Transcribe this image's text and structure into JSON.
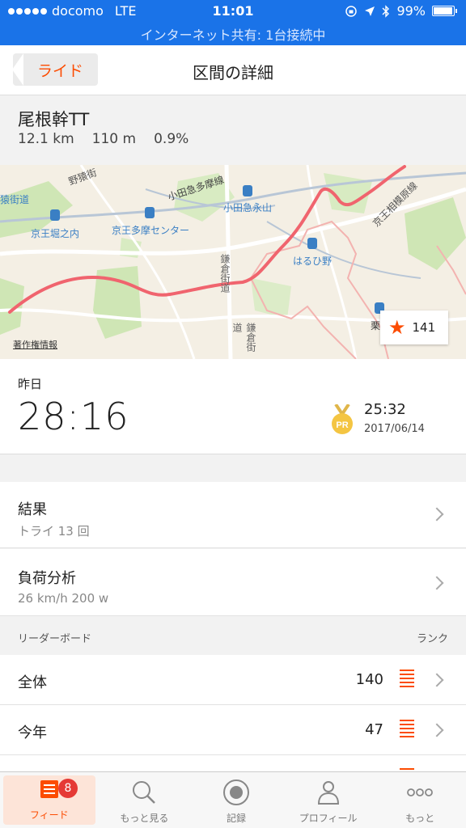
{
  "status_bar": {
    "carrier": "docomo",
    "network": "LTE",
    "time": "11:01",
    "battery": "99%",
    "battery_level": 0.99,
    "hotspot": "インターネット共有: 1台接続中"
  },
  "nav": {
    "back_label": "ライド",
    "title": "区間の詳細"
  },
  "segment": {
    "name": "尾根幹TT",
    "distance": "12.1 km",
    "elevation": "110 m",
    "grade": "0.9%"
  },
  "map": {
    "labels": {
      "odakyu_tama_line": "小田急多摩線",
      "odakyu_nagayama": "小田急永山",
      "keio_horinouchi": "京王堀之内",
      "keio_tama_center": "京王多摩センター",
      "harumino": "はるひ野",
      "keio_sagamihara_line": "京王相模原線",
      "kamakura_kaido_1": "鎌倉街道",
      "kamakura_kaido_2": "鎌倉街道",
      "nozaru": "野猿街",
      "kaido": "猿街道",
      "kuri": "栗"
    },
    "copyright": "著作権情報",
    "rank_badge": "141",
    "colors": {
      "route": "#f0646e",
      "accent": "#fc4c02"
    }
  },
  "effort": {
    "label": "昨日",
    "time": "28:16",
    "pr_badge": "PR",
    "pr_time": "25:32",
    "pr_date": "2017/06/14"
  },
  "results": {
    "title": "結果",
    "subtitle": "トライ 13 回"
  },
  "power": {
    "title": "負荷分析",
    "subtitle": "26 km/h 200 w"
  },
  "leaderboard": {
    "header_left": "リーダーボード",
    "header_right": "ランク",
    "rows": [
      {
        "label": "全体",
        "rank": "140"
      },
      {
        "label": "今年",
        "rank": "47"
      }
    ]
  },
  "tabs": [
    {
      "label": "フィード",
      "icon": "feed-icon",
      "badge": "8"
    },
    {
      "label": "もっと見る",
      "icon": "search-icon"
    },
    {
      "label": "記録",
      "icon": "record-icon"
    },
    {
      "label": "プロフィール",
      "icon": "profile-icon"
    },
    {
      "label": "もっと",
      "icon": "more-icon"
    }
  ]
}
